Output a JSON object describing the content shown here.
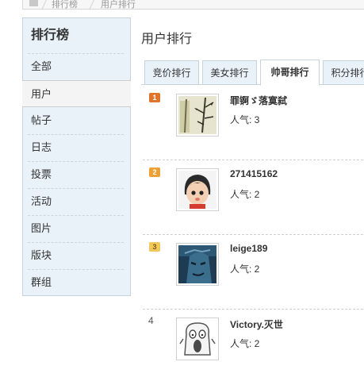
{
  "breadcrumb": {
    "items": [
      "排行榜",
      "用户排行"
    ]
  },
  "sidebar": {
    "title": "排行榜",
    "items": [
      {
        "label": "全部"
      },
      {
        "label": "用户"
      },
      {
        "label": "帖子"
      },
      {
        "label": "日志"
      },
      {
        "label": "投票"
      },
      {
        "label": "活动"
      },
      {
        "label": "图片"
      },
      {
        "label": "版块"
      },
      {
        "label": "群组"
      }
    ],
    "active_index": 1
  },
  "main": {
    "title": "用户排行",
    "tabs": [
      {
        "label": "竞价排行"
      },
      {
        "label": "美女排行"
      },
      {
        "label": "帅哥排行"
      },
      {
        "label": "积分排行"
      }
    ],
    "active_tab": 2,
    "ranking": [
      {
        "rank": "1",
        "name": "罪锕ゞ落寞弑",
        "popularity": "人气: 3",
        "avatar": "bamboo-painting-avatar"
      },
      {
        "rank": "2",
        "name": "271415162",
        "popularity": "人气: 2",
        "avatar": "cartoon-child-avatar"
      },
      {
        "rank": "3",
        "name": "leige189",
        "popularity": "人气: 2",
        "avatar": "blue-face-avatar"
      },
      {
        "rank": "4",
        "name": "Victory.灭世",
        "popularity": "人气: 2",
        "avatar": "shocked-doodle-avatar"
      }
    ]
  },
  "colors": {
    "sidebar_bg": "#e9f1f9",
    "border": "#c6d3df",
    "rank1": "#e2732b",
    "rank2": "#eda033",
    "rank3": "#f2c75a"
  }
}
